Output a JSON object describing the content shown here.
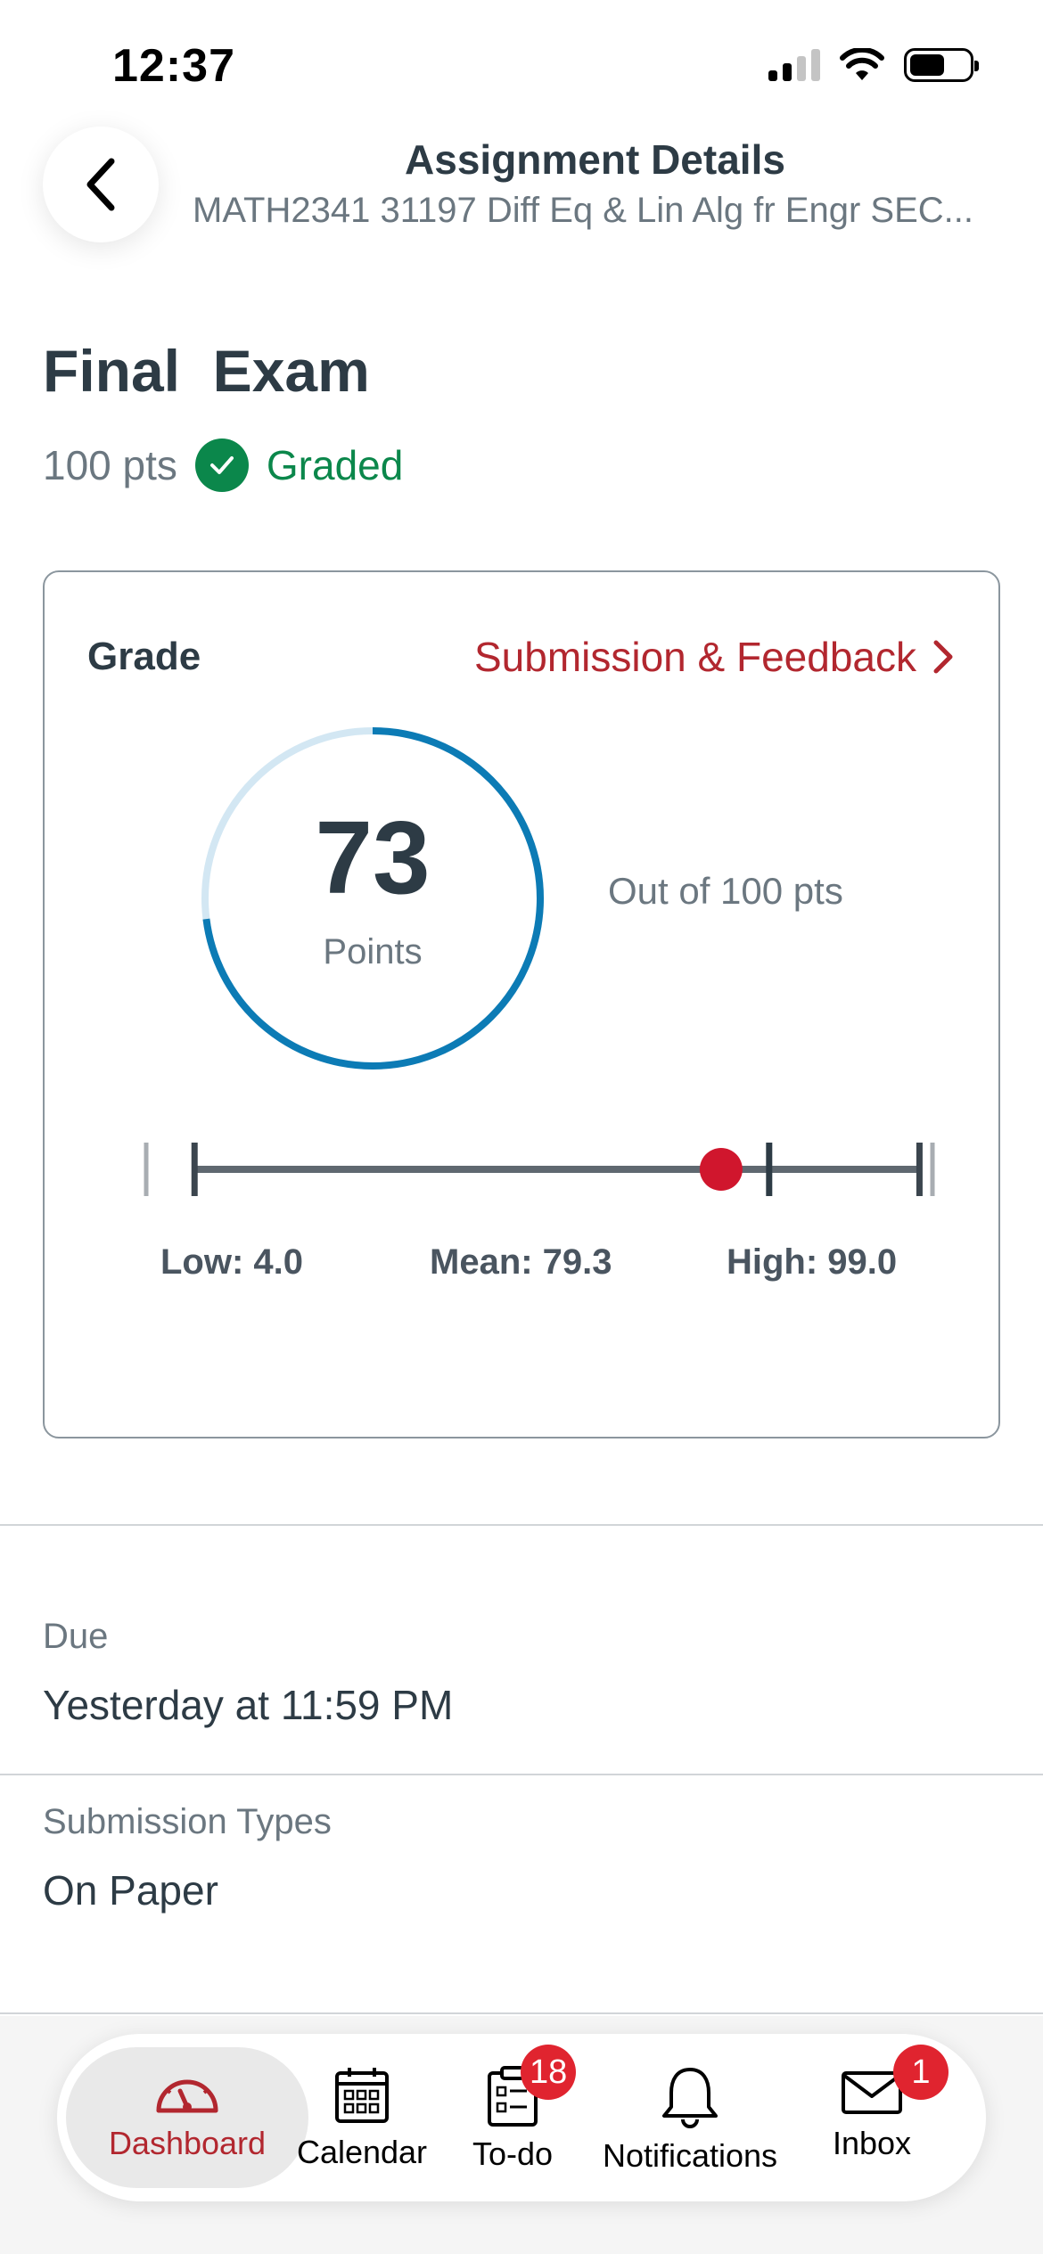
{
  "status_bar": {
    "time": "12:37"
  },
  "header": {
    "title": "Assignment Details",
    "subtitle": "MATH2341 31197 Diff Eq & Lin Alg fr Engr SEC..."
  },
  "assignment": {
    "title": "Final  Exam",
    "points_possible": "100 pts",
    "status": "Graded"
  },
  "grade_card": {
    "label": "Grade",
    "feedback_link": "Submission & Feedback",
    "score": "73",
    "score_unit": "Points",
    "out_of": "Out of 100 pts",
    "score_fraction": 0.73,
    "stats": {
      "low_label": "Low: 4.0",
      "mean_label": "Mean: 79.3",
      "high_label": "High: 99.0",
      "low": 4.0,
      "mean": 79.3,
      "high": 99.0,
      "score": 73
    }
  },
  "details": {
    "due_label": "Due",
    "due_value": "Yesterday at 11:59 PM",
    "submission_types_label": "Submission Types",
    "submission_types_value": "On Paper"
  },
  "tab_bar": {
    "items": [
      {
        "label": "Dashboard",
        "icon": "dashboard-icon",
        "active": true
      },
      {
        "label": "Calendar",
        "icon": "calendar-icon"
      },
      {
        "label": "To-do",
        "icon": "todo-icon",
        "badge": "18"
      },
      {
        "label": "Notifications",
        "icon": "bell-icon"
      },
      {
        "label": "Inbox",
        "icon": "envelope-icon",
        "badge": "1"
      }
    ]
  },
  "colors": {
    "brand_red": "#b2272f",
    "graded_green": "#0b874b",
    "ring_blue": "#0c7bb5",
    "ring_track": "#d3e7f3",
    "score_marker": "#d0162d"
  }
}
